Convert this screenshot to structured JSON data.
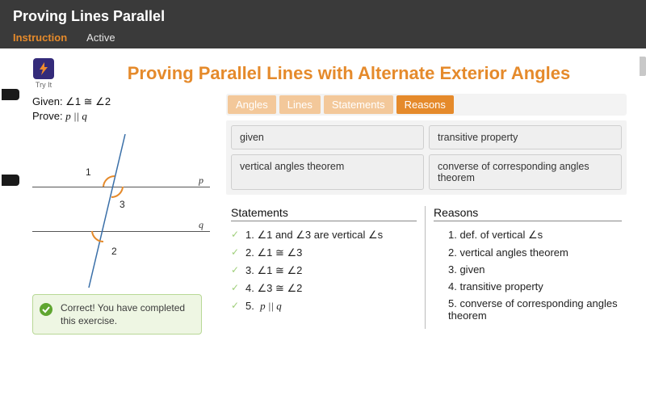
{
  "header": {
    "title": "Proving Lines Parallel",
    "tabs": {
      "instruction": "Instruction",
      "active": "Active"
    },
    "current_tab": "instruction"
  },
  "tryit_label": "Try It",
  "lesson_title": "Proving Parallel Lines with Alternate Exterior Angles",
  "problem": {
    "given": "Given: ∠1 ≅ ∠2",
    "prove_label": "Prove:",
    "prove_symbolic": "p || q"
  },
  "diagram": {
    "line_p": "p",
    "line_q": "q",
    "angle1": "1",
    "angle2": "2",
    "angle3": "3"
  },
  "feedback": "Correct! You have completed this exercise.",
  "categories": {
    "items": [
      "Angles",
      "Lines",
      "Statements",
      "Reasons"
    ],
    "selected_index": 3
  },
  "answer_chips": [
    "given",
    "transitive property",
    "vertical angles theorem",
    "converse of corresponding angles theorem"
  ],
  "proof": {
    "statements_header": "Statements",
    "reasons_header": "Reasons",
    "statements": [
      "1.  ∠1 and ∠3 are vertical ∠s",
      "2.  ∠1 ≅ ∠3",
      "3.  ∠1 ≅ ∠2",
      "4.  ∠3 ≅ ∠2",
      "5.  p || q"
    ],
    "reasons": [
      "1. def. of vertical ∠s",
      "2. vertical angles theorem",
      "3. given",
      "4. transitive property",
      "5. converse of corresponding angles theorem"
    ]
  }
}
